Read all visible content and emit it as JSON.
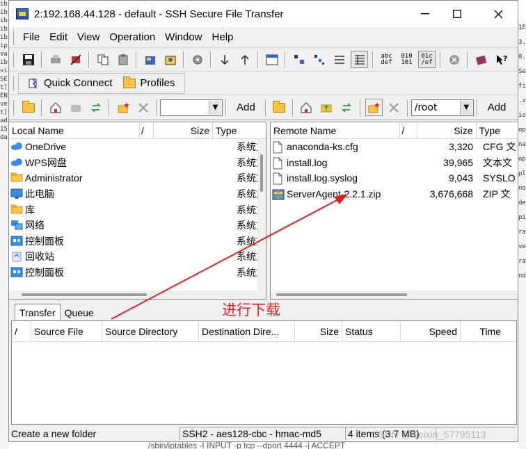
{
  "window": {
    "title": "2:192.168.44.128 - default - SSH Secure File Transfer"
  },
  "menu": [
    "File",
    "Edit",
    "View",
    "Operation",
    "Window",
    "Help"
  ],
  "toolbar_text": {
    "tb1": "abc\ndef",
    "tb2": "010\n101",
    "tb3": "01c\n/ef"
  },
  "quickbar": {
    "quick_connect": "Quick Connect",
    "profiles": "Profiles"
  },
  "local_nav": {
    "path": "",
    "add": "Add"
  },
  "remote_nav": {
    "path": "/root",
    "add": "Add"
  },
  "local_pane": {
    "headers": {
      "name": "Local Name",
      "slash": "/",
      "size": "Size",
      "type": "Type"
    },
    "rows": [
      {
        "name": "OneDrive",
        "type": "系统文",
        "icon": "cloud-icon"
      },
      {
        "name": "WPS网盘",
        "type": "系统文",
        "icon": "cloud-icon"
      },
      {
        "name": "Administrator",
        "type": "系统文",
        "icon": "folder-icon"
      },
      {
        "name": "此电脑",
        "type": "系统文",
        "icon": "computer-icon"
      },
      {
        "name": "库",
        "type": "系统文",
        "icon": "folder-icon"
      },
      {
        "name": "网络",
        "type": "系统文",
        "icon": "network-icon"
      },
      {
        "name": "控制面板",
        "type": "系统文",
        "icon": "control-panel-icon"
      },
      {
        "name": "回收站",
        "type": "系统文",
        "icon": "recycle-bin-icon"
      },
      {
        "name": "控制面板",
        "type": "系统文",
        "icon": "control-panel-icon"
      }
    ]
  },
  "remote_pane": {
    "headers": {
      "name": "Remote Name",
      "slash": "/",
      "size": "Size",
      "type": "Type"
    },
    "rows": [
      {
        "name": "anaconda-ks.cfg",
        "size": "3,320",
        "type": "CFG 文",
        "icon": "file-icon"
      },
      {
        "name": "install.log",
        "size": "39,965",
        "type": "文本文",
        "icon": "file-icon"
      },
      {
        "name": "install.log.syslog",
        "size": "9,043",
        "type": "SYSLO",
        "icon": "file-icon"
      },
      {
        "name": "ServerAgent-2.2.1.zip",
        "size": "3,676,668",
        "type": "ZIP 文",
        "icon": "zip-icon"
      }
    ]
  },
  "tabs": [
    "Transfer",
    "Queue"
  ],
  "transfer_headers": [
    "/",
    "Source File",
    "Source Directory",
    "Destination Dire...",
    "Size",
    "Status",
    "Speed",
    "Time"
  ],
  "status": {
    "message": "Create a new folder",
    "cipher": "SSH2 - aes128-cbc - hmac-md5",
    "items": "4 items (3.7 MB)"
  },
  "annotation": {
    "text": "进行下载",
    "color": "#e02020"
  },
  "watermark": "CSDN @weixin_57795113",
  "bg_terminal": {
    "bottom": "/sbin/iptables -I INPUT -p tcp --dport 4444 -j ACCEPT",
    "left": [
      "ib",
      "ib",
      "ib",
      "ib",
      "ib",
      "ip",
      "va",
      "ib",
      "vi",
      "SE",
      "t]",
      "EN",
      "ve",
      "t]",
      "ad",
      "15",
      "da"
    ],
    "right": [
      "1E",
      "3.",
      "0.",
      "Se",
      "fi",
      ".z",
      "io",
      "op",
      "na",
      "op",
      "pl",
      "no",
      "de",
      "pi",
      "ra",
      "ve",
      "ra",
      "nd"
    ]
  }
}
